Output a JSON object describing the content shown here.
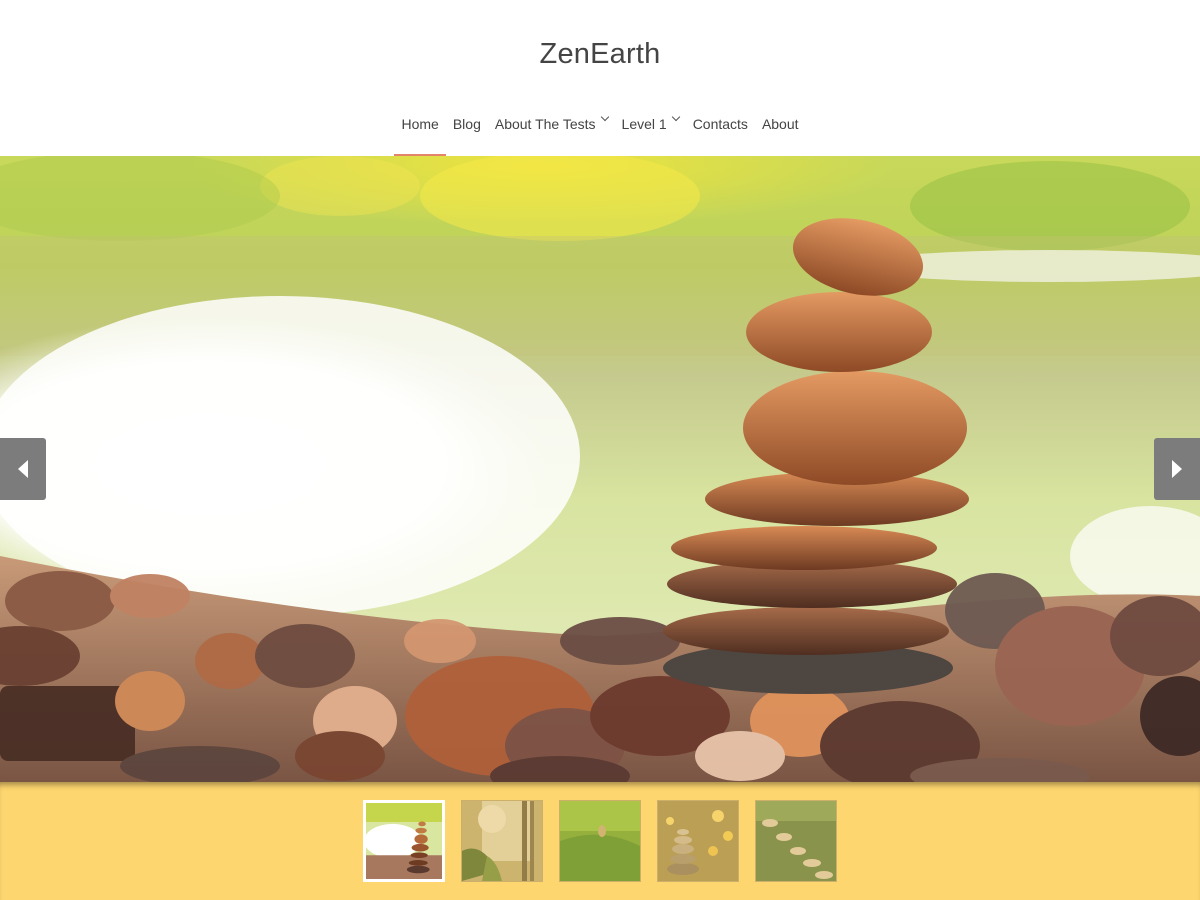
{
  "site": {
    "title": "ZenEarth"
  },
  "nav": {
    "items": [
      {
        "label": "Home",
        "active": true,
        "has_submenu": false
      },
      {
        "label": "Blog",
        "active": false,
        "has_submenu": false
      },
      {
        "label": "About The Tests",
        "active": false,
        "has_submenu": true
      },
      {
        "label": "Level 1",
        "active": false,
        "has_submenu": true
      },
      {
        "label": "Contacts",
        "active": false,
        "has_submenu": false
      },
      {
        "label": "About",
        "active": false,
        "has_submenu": false
      }
    ]
  },
  "slider": {
    "prev_icon": "arrow-left-icon",
    "next_icon": "arrow-right-icon",
    "thumbnails": [
      {
        "name": "stacked-stones",
        "active": true
      },
      {
        "name": "garden-bamboo",
        "active": false
      },
      {
        "name": "green-grass",
        "active": false
      },
      {
        "name": "stones-bokeh",
        "active": false
      },
      {
        "name": "stepping-stones",
        "active": false
      }
    ]
  },
  "colors": {
    "accent_underline": "#e2856b",
    "thumb_strip_bg": "#fed66f",
    "arrow_bg": "#7c7c7c"
  }
}
